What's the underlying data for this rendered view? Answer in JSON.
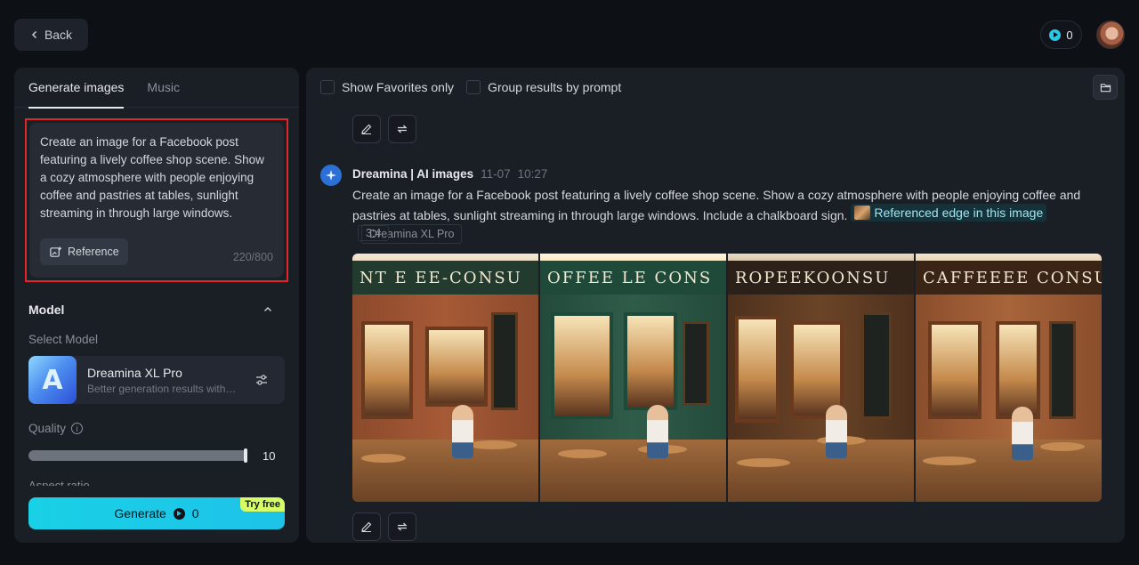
{
  "header": {
    "back_label": "Back",
    "credits": "0"
  },
  "left_panel": {
    "tabs": [
      {
        "label": "Generate images",
        "active": true
      },
      {
        "label": "Music",
        "active": false
      }
    ],
    "prompt": {
      "text": "Create an image for a Facebook post featuring a lively coffee shop scene. Show a cozy atmosphere with people enjoying coffee and pastries at tables, sunlight streaming in through large windows. Include a chalkboard sign.",
      "char_count": "220/800",
      "reference_label": "Reference"
    },
    "model_section": {
      "title": "Model",
      "select_label": "Select Model",
      "model_name": "Dreamina XL Pro",
      "model_desc": "Better generation results with profound understanding",
      "thumb_letter": "A"
    },
    "quality": {
      "label": "Quality",
      "value": "10",
      "level_fraction": 1.0
    },
    "next_section_label": "Aspect ratio",
    "generate": {
      "label": "Generate",
      "cost": "0",
      "badge": "Try free"
    }
  },
  "right_panel": {
    "toolbar": {
      "favorites_label": "Show Favorites only",
      "group_label": "Group results by prompt"
    },
    "message": {
      "sender": "Dreamina | AI images",
      "date": "11-07",
      "time": "10:27",
      "prompt": "Create an image for a Facebook post featuring a lively coffee shop scene. Show a cozy atmosphere with people enjoying coffee and pastries at tables, sunlight streaming in through large windows. Include a chalkboard sign.",
      "reference_chip": "Referenced edge in this image",
      "model_tag": "Dreamina XL Pro",
      "ratio_tag": "3:4"
    },
    "images": [
      {
        "sign": "NT E  EE-CONSU",
        "style": "brick"
      },
      {
        "sign": "OFFEE  LE  CONS",
        "style": "green"
      },
      {
        "sign": "ROPEEKOONSU",
        "style": "wood"
      },
      {
        "sign": "CAFFEEEE  CONSU",
        "style": "brick2"
      }
    ]
  },
  "colors": {
    "accent": "#1ec3e8",
    "highlight_border": "#e0252b",
    "badge": "#d6ff67"
  }
}
